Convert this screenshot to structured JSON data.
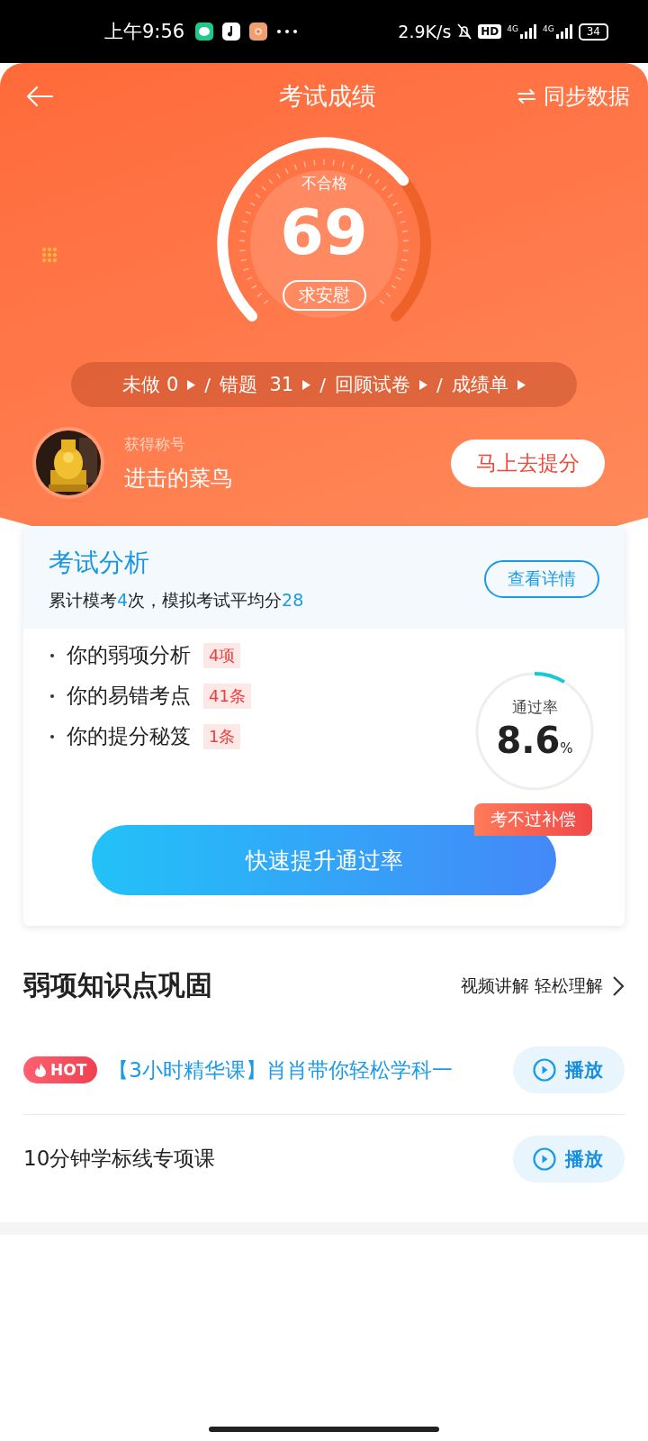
{
  "status_bar": {
    "time": "上午9:56",
    "speed": "2.9K/s",
    "hd": "HD",
    "networks": [
      "4G",
      "4G"
    ],
    "battery": "34"
  },
  "nav": {
    "title": "考试成绩",
    "action": "同步数据"
  },
  "score": {
    "verdict": "不合格",
    "value": "69",
    "comfort_button": "求安慰"
  },
  "stats": [
    {
      "label": "未做 0"
    },
    {
      "separator": "/",
      "label": "错题  31"
    },
    {
      "separator": "/",
      "label": "回顾试卷"
    },
    {
      "separator": "/",
      "label": "成绩单"
    }
  ],
  "honor": {
    "label": "获得称号",
    "name": "进击的菜鸟",
    "button": "马上去提分"
  },
  "analysis": {
    "title": "考试分析",
    "summary": [
      {
        "text": "累计模考",
        "highlight": false
      },
      {
        "text": "4",
        "highlight": true
      },
      {
        "text": "次，模拟考试平均分",
        "highlight": false
      },
      {
        "text": "28",
        "highlight": true
      }
    ],
    "details_button": "查看详情",
    "items": [
      {
        "text": "你的弱项分析",
        "count": "4项"
      },
      {
        "text": "你的易错考点",
        "count": "41条"
      },
      {
        "text": "你的提分秘笈",
        "count": "1条"
      }
    ],
    "pass_rate": {
      "label": "通过率",
      "value": "8.6",
      "unit": "%",
      "level": 0.086
    },
    "tag": "考不过补偿",
    "cta": "快速提升通过率"
  },
  "weak_points": {
    "title": "弱项知识点巩固",
    "more": "视频讲解 轻松理解",
    "courses": [
      {
        "hot": true,
        "badge": "HOT",
        "title": "【3小时精华课】肖肖带你轻松学科一",
        "play": "播放"
      },
      {
        "hot": false,
        "title": "10分钟学标线专项课",
        "play": "播放"
      }
    ]
  }
}
